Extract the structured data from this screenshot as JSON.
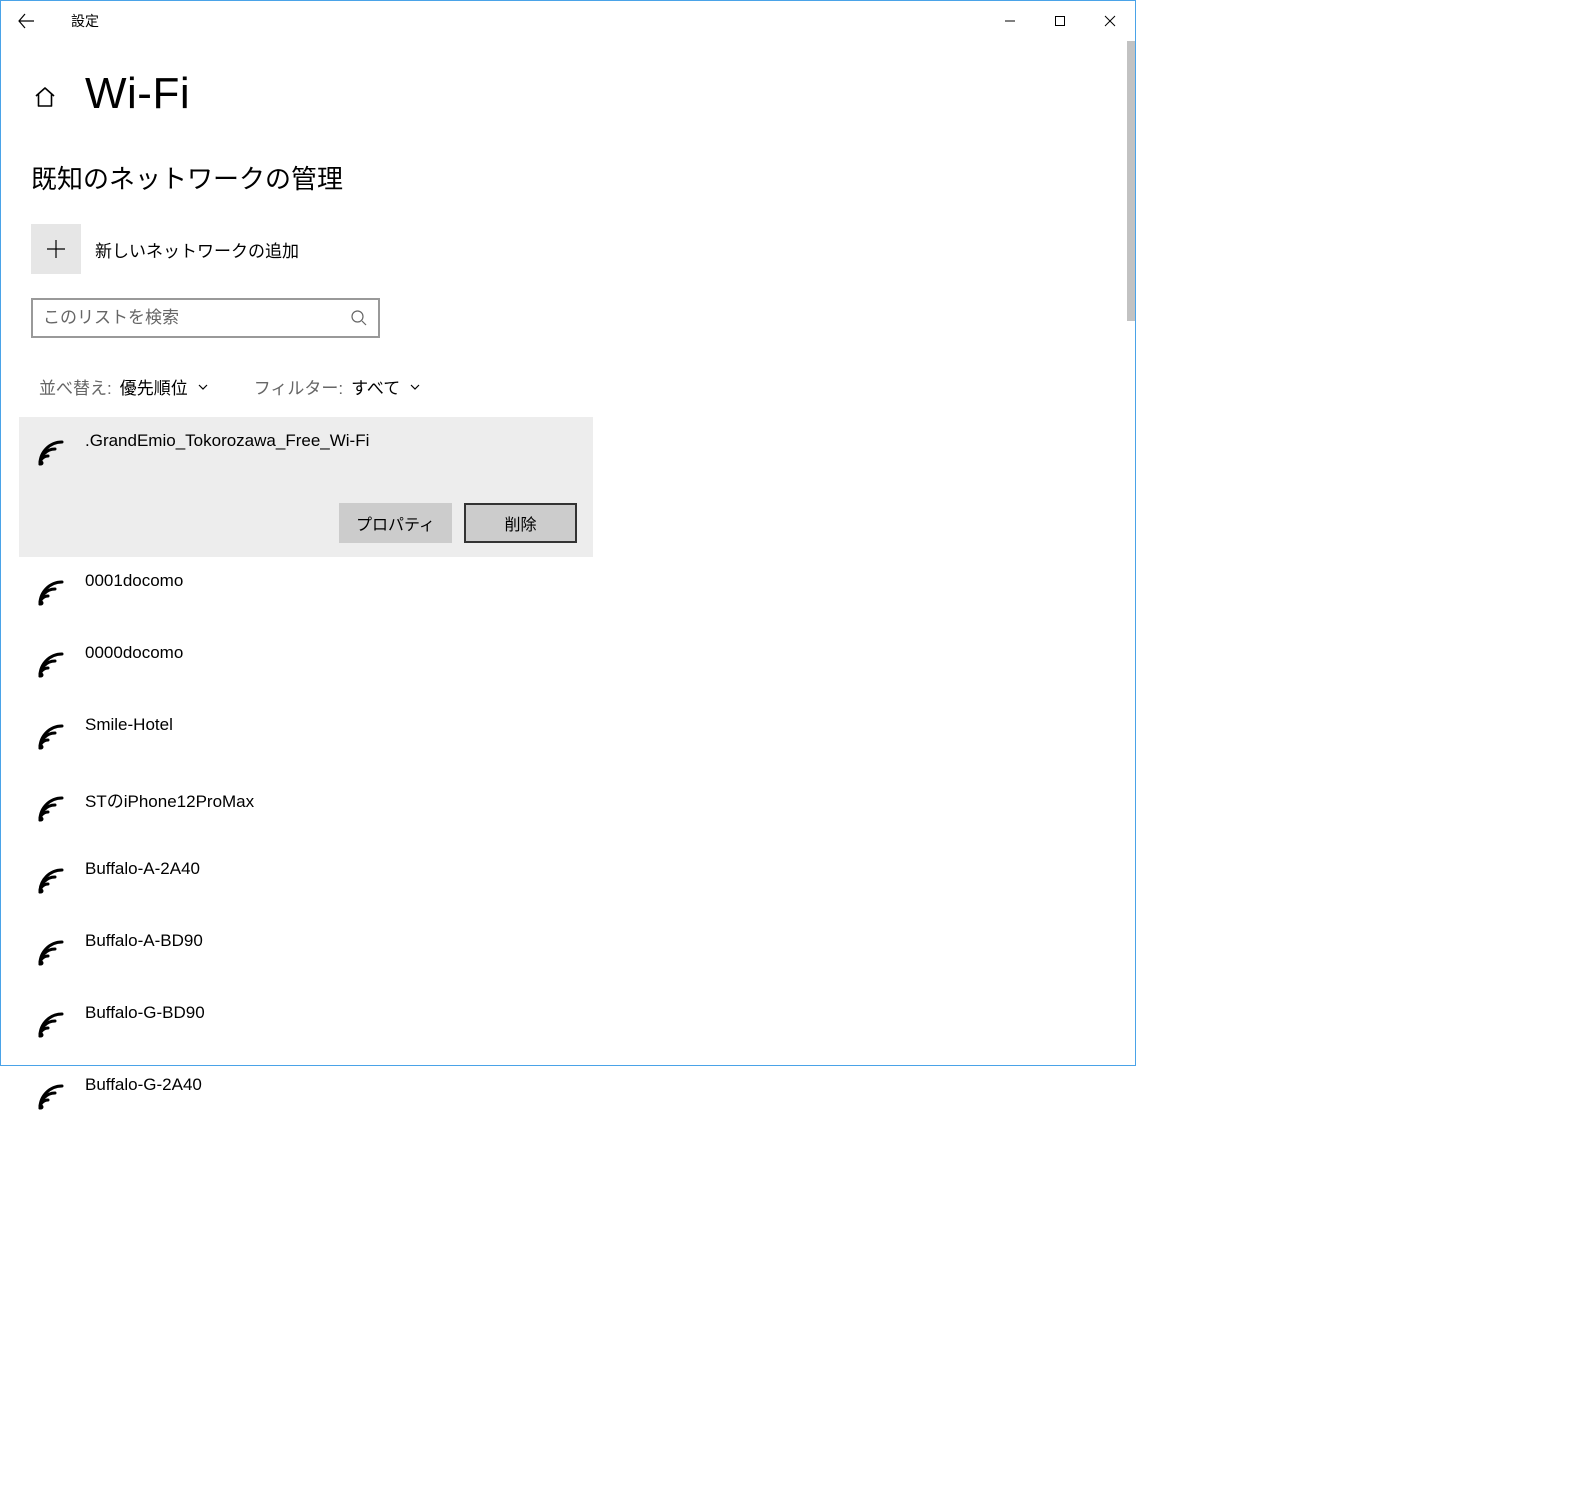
{
  "window": {
    "app_title": "設定"
  },
  "page": {
    "title": "Wi-Fi",
    "section_title": "既知のネットワークの管理",
    "add_network_label": "新しいネットワークの追加",
    "search_placeholder": "このリストを検索"
  },
  "filters": {
    "sort_label": "並べ替え:",
    "sort_value": "優先順位",
    "filter_label": "フィルター:",
    "filter_value": "すべて"
  },
  "actions": {
    "properties": "プロパティ",
    "forget": "削除"
  },
  "networks": [
    {
      "name": ".GrandEmio_Tokorozawa_Free_Wi-Fi",
      "selected": true
    },
    {
      "name": "0001docomo",
      "selected": false
    },
    {
      "name": "0000docomo",
      "selected": false
    },
    {
      "name": "Smile-Hotel",
      "selected": false
    },
    {
      "name": "STのiPhone12ProMax",
      "selected": false
    },
    {
      "name": "Buffalo-A-2A40",
      "selected": false
    },
    {
      "name": "Buffalo-A-BD90",
      "selected": false
    },
    {
      "name": "Buffalo-G-BD90",
      "selected": false
    },
    {
      "name": "Buffalo-G-2A40",
      "selected": false
    }
  ]
}
